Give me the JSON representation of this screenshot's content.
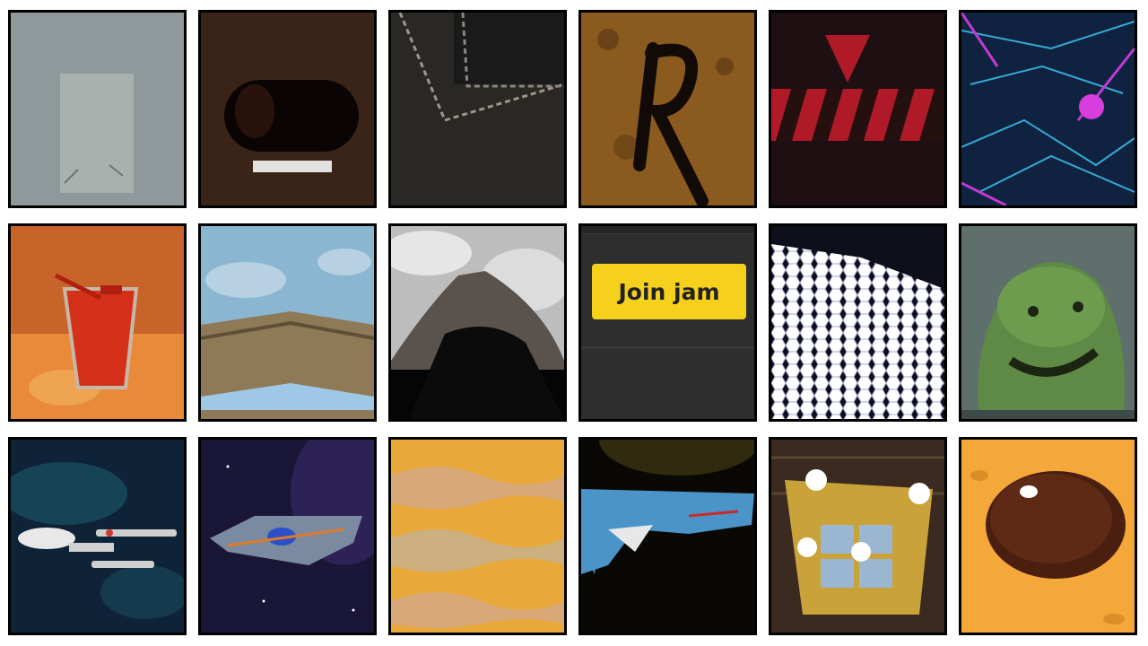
{
  "tiles": [
    {
      "name": "tile-gray-panel"
    },
    {
      "name": "tile-dark-oval-object"
    },
    {
      "name": "tile-dark-stitched-leather"
    },
    {
      "name": "tile-grunge-r-letter"
    },
    {
      "name": "tile-red-warning-stripes"
    },
    {
      "name": "tile-neon-mech"
    },
    {
      "name": "tile-red-cup"
    },
    {
      "name": "tile-sky-roof"
    },
    {
      "name": "tile-gray-peak"
    },
    {
      "name": "tile-join-jam"
    },
    {
      "name": "tile-hex-mesh"
    },
    {
      "name": "tile-green-creature"
    },
    {
      "name": "tile-starship-enterprise"
    },
    {
      "name": "tile-alien-spaceship"
    },
    {
      "name": "tile-sand-waves"
    },
    {
      "name": "tile-pixel-shark"
    },
    {
      "name": "tile-gold-chest"
    },
    {
      "name": "tile-chocolate-button"
    }
  ],
  "join_jam": {
    "label": "Join jam",
    "button_color": "#f5d11e"
  }
}
